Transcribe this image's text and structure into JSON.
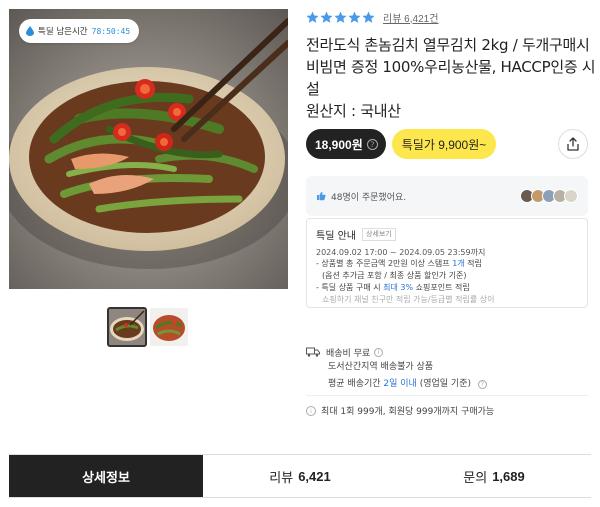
{
  "badge": {
    "label": "특딜 남은시간",
    "time": "78:50:45"
  },
  "rating": {
    "stars": 5,
    "review_text": "리뷰 6,421건"
  },
  "product": {
    "title": "전라도식 촌놈김치 열무김치 2kg / 두개구매시 비빔면 증정 100%우리농산물, HACCP인증 시설",
    "origin": "원산지 : 국내산"
  },
  "price": {
    "original": "18,900원",
    "deal": "특딜가 9,900원~"
  },
  "buyers": {
    "text": "48명이 주문했어요."
  },
  "deal_info": {
    "title": "특딜 안내",
    "detail_tag": "상세보기",
    "period": "2024.09.02 17:00 ~ 2024.09.05 23:59까지",
    "bullet1_pre": "- 상품별 총 주문금액 2만원 이상 스탬프 ",
    "bullet1_hl": "1개",
    "bullet1_post": " 적립",
    "bullet1_sub": "(옵션 추가금 포함 / 최종 상품 할인가 기준)",
    "bullet2_pre": "- 특딜 상품 구매 시 ",
    "bullet2_hl": "최대 3%",
    "bullet2_post": " 쇼핑포인트 적립",
    "bullet2_note": "쇼핑하기 채널 친구만 적립 가능/등급별 적립률 상이"
  },
  "shipping": {
    "fee": "배송비 무료",
    "region": "도서산간지역 배송불가 상품",
    "avg_pre": "평균 배송기간 ",
    "avg_hl": "2일 이내",
    "avg_post": " (영업일 기준)"
  },
  "limit": {
    "text": "최대 1회 999개, 회원당 999개까지 구매가능"
  },
  "tabs": [
    {
      "label": "상세정보",
      "count": ""
    },
    {
      "label": "리뷰",
      "count": "6,421"
    },
    {
      "label": "문의",
      "count": "1,689"
    }
  ],
  "colors": {
    "star": "#4a9ae8",
    "deal_yellow": "#fde74c",
    "accent_blue": "#2a73d6",
    "dark": "#222222"
  },
  "icons": [
    "drop-icon",
    "star-icon",
    "info-icon",
    "share-icon",
    "thumbs-up-icon",
    "truck-icon",
    "question-icon"
  ]
}
